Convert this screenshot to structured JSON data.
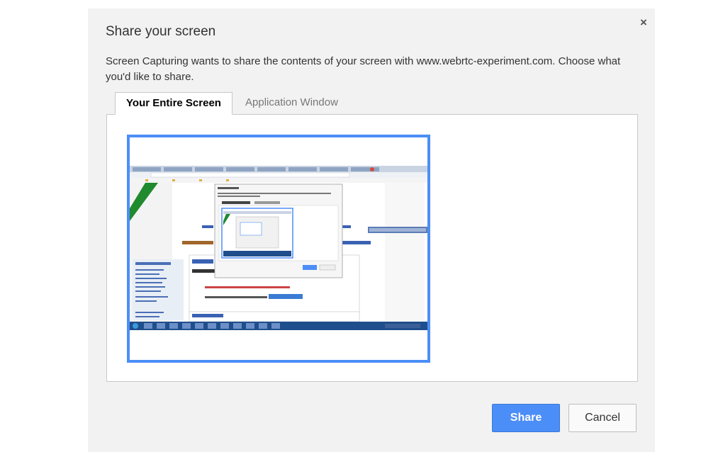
{
  "dialog": {
    "title": "Share your screen",
    "close_glyph": "×",
    "description": "Screen Capturing wants to share the contents of your screen with www.webrtc-experiment.com. Choose what you'd like to share."
  },
  "tabs": [
    {
      "label": "Your Entire Screen",
      "selected": true
    },
    {
      "label": "Application Window",
      "selected": false
    }
  ],
  "preview": {
    "description": "Thumbnail of entire screen (selected)",
    "selected_border_color": "#4c8ef7"
  },
  "buttons": {
    "share": "Share",
    "cancel": "Cancel"
  },
  "colors": {
    "accent": "#4c8ef7",
    "dialog_bg": "#f2f2f2",
    "taskbar": "#1f4e8c"
  },
  "icons": [
    "close-icon"
  ]
}
